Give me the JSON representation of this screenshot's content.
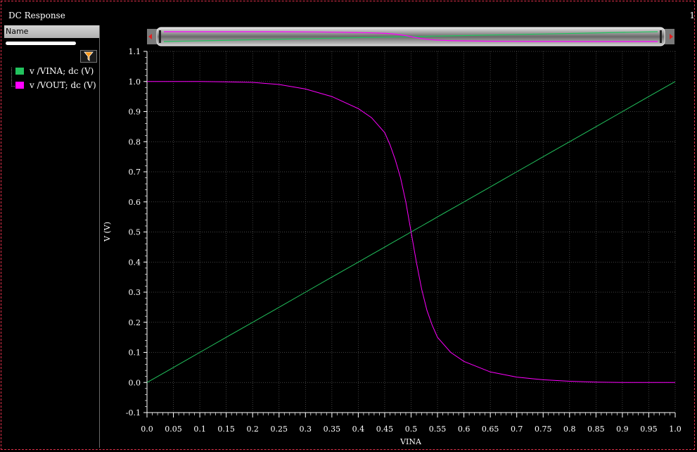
{
  "window": {
    "title": "DC Response",
    "panel_number": "1"
  },
  "sidebar": {
    "column_header": "Name",
    "legend": [
      {
        "label": "v /VINA; dc (V)",
        "color": "#22c35e"
      },
      {
        "label": "v /VOUT; dc (V)",
        "color": "#ff00ff"
      }
    ],
    "filter_icon": "funnel-icon"
  },
  "colors": {
    "background": "#000000",
    "grid": "#5a5a5a",
    "frame_border": "#e0304a"
  },
  "chart_data": {
    "type": "line",
    "title": "",
    "xlabel": "VINA",
    "ylabel": "V (V)",
    "xlim": [
      0.0,
      1.0
    ],
    "ylim": [
      -0.1,
      1.1
    ],
    "grid": true,
    "legend_placement": "left-sidebar",
    "x_ticks": [
      "0.0",
      "0.05",
      "0.1",
      "0.15",
      "0.2",
      "0.25",
      "0.3",
      "0.35",
      "0.4",
      "0.45",
      "0.5",
      "0.55",
      "0.6",
      "0.65",
      "0.7",
      "0.75",
      "0.8",
      "0.85",
      "0.9",
      "0.95",
      "1.0"
    ],
    "y_ticks": [
      "-0.1",
      "0.0",
      "0.1",
      "0.2",
      "0.3",
      "0.4",
      "0.5",
      "0.6",
      "0.7",
      "0.8",
      "0.9",
      "1.0",
      "1.1"
    ],
    "x": [
      0.0,
      0.05,
      0.1,
      0.15,
      0.2,
      0.25,
      0.3,
      0.35,
      0.4,
      0.425,
      0.45,
      0.46,
      0.47,
      0.48,
      0.49,
      0.5,
      0.51,
      0.52,
      0.53,
      0.54,
      0.55,
      0.575,
      0.6,
      0.65,
      0.7,
      0.75,
      0.8,
      0.85,
      0.9,
      0.95,
      1.0
    ],
    "series": [
      {
        "name": "v /VINA; dc (V)",
        "color": "#22c35e",
        "values": [
          0.0,
          0.05,
          0.1,
          0.15,
          0.2,
          0.25,
          0.3,
          0.35,
          0.4,
          0.425,
          0.45,
          0.46,
          0.47,
          0.48,
          0.49,
          0.5,
          0.51,
          0.52,
          0.53,
          0.54,
          0.55,
          0.575,
          0.6,
          0.65,
          0.7,
          0.75,
          0.8,
          0.85,
          0.9,
          0.95,
          1.0
        ]
      },
      {
        "name": "v /VOUT; dc (V)",
        "color": "#ff00ff",
        "values": [
          1.0,
          1.0,
          1.0,
          0.999,
          0.997,
          0.99,
          0.975,
          0.95,
          0.91,
          0.88,
          0.83,
          0.79,
          0.74,
          0.68,
          0.6,
          0.5,
          0.4,
          0.31,
          0.24,
          0.19,
          0.15,
          0.1,
          0.07,
          0.035,
          0.018,
          0.009,
          0.004,
          0.001,
          0.0,
          0.0,
          0.0
        ]
      }
    ]
  }
}
